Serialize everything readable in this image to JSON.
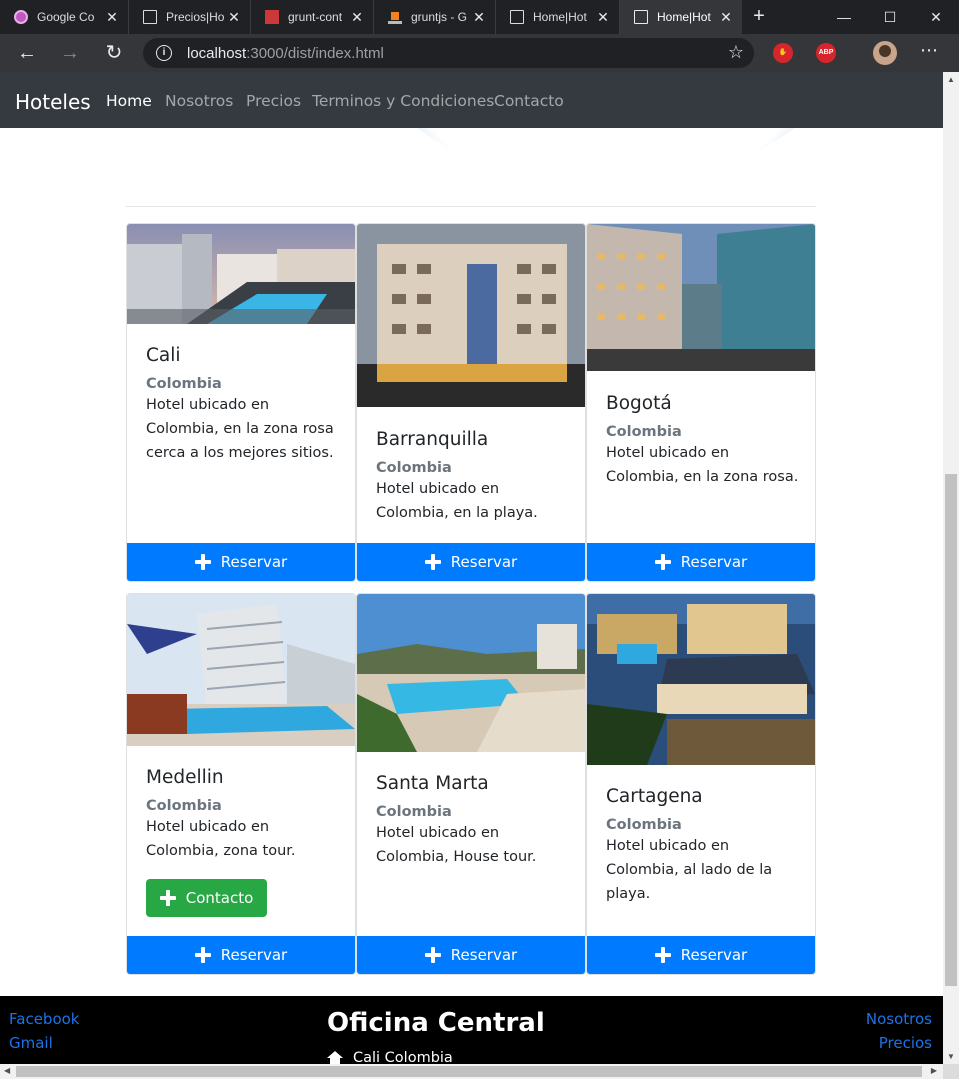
{
  "browser": {
    "tabs": [
      {
        "title": "Google Co",
        "icon": "purple-circle-icon",
        "color": "#c058c0"
      },
      {
        "title": "Precios|Ho",
        "icon": "page-icon"
      },
      {
        "title": "grunt-cont",
        "icon": "npm-icon",
        "color": "#cb3837"
      },
      {
        "title": "gruntjs - G",
        "icon": "stackoverflow-icon",
        "color": "#f48024"
      },
      {
        "title": "Home|Hot",
        "icon": "page-icon"
      },
      {
        "title": "Home|Hot",
        "icon": "page-icon",
        "active": true
      }
    ],
    "url_host": "localhost",
    "url_path": ":3000/dist/index.html",
    "extensions": [
      "ABP"
    ]
  },
  "site": {
    "brand": "Hoteles",
    "nav": [
      "Home",
      "Nosotros",
      "Precios",
      "Terminos y Condiciones",
      "Contacto"
    ],
    "active_nav": "Home"
  },
  "cards": [
    {
      "city": "Cali",
      "country": "Colombia",
      "desc": "Hotel ubicado en Colombia, en la zona rosa cerca a los mejores sitios.",
      "button": "Reservar"
    },
    {
      "city": "Barranquilla",
      "country": "Colombia",
      "desc": "Hotel ubicado en Colombia, en la playa.",
      "button": "Reservar"
    },
    {
      "city": "Bogotá",
      "country": "Colombia",
      "desc": "Hotel ubicado en Colombia, en la zona rosa.",
      "button": "Reservar"
    },
    {
      "city": "Medellin",
      "country": "Colombia",
      "desc": "Hotel ubicado en Colombia, zona tour.",
      "button": "Reservar",
      "contact": "Contacto"
    },
    {
      "city": "Santa Marta",
      "country": "Colombia",
      "desc": "Hotel ubicado en Colombia, House tour.",
      "button": "Reservar"
    },
    {
      "city": "Cartagena",
      "country": "Colombia",
      "desc": "Hotel ubicado en Colombia, al lado de la playa.",
      "button": "Reservar"
    }
  ],
  "footer": {
    "left_links": [
      "Facebook",
      "Gmail"
    ],
    "title": "Oficina Central",
    "address": "Cali Colombia",
    "right_links": [
      "Nosotros",
      "Precios"
    ]
  },
  "colors": {
    "primary": "#007bff",
    "success": "#28a745",
    "navbar": "#343a40",
    "muted": "#6c757d"
  }
}
